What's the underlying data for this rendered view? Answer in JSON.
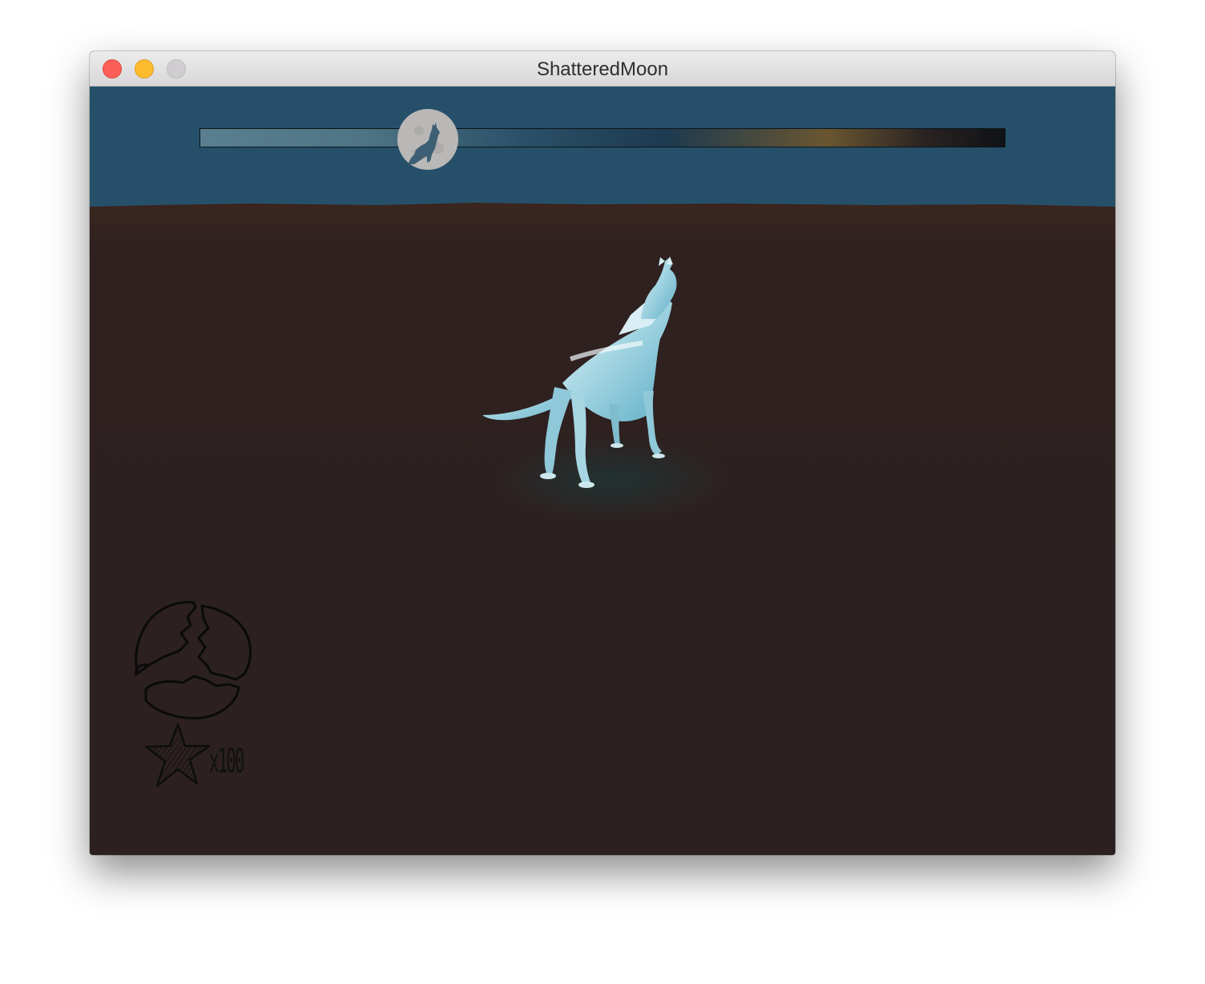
{
  "window": {
    "title": "ShatteredMoon"
  },
  "hud": {
    "timeline": {
      "progress": 0.28
    },
    "moon_fragments": {
      "icon": "shattered-moon-icon"
    },
    "stars": {
      "icon": "star-icon",
      "count_label": "x100"
    }
  },
  "scene": {
    "sky_color": "#265069",
    "ground_color": "#2c2020",
    "player": "wolf"
  }
}
